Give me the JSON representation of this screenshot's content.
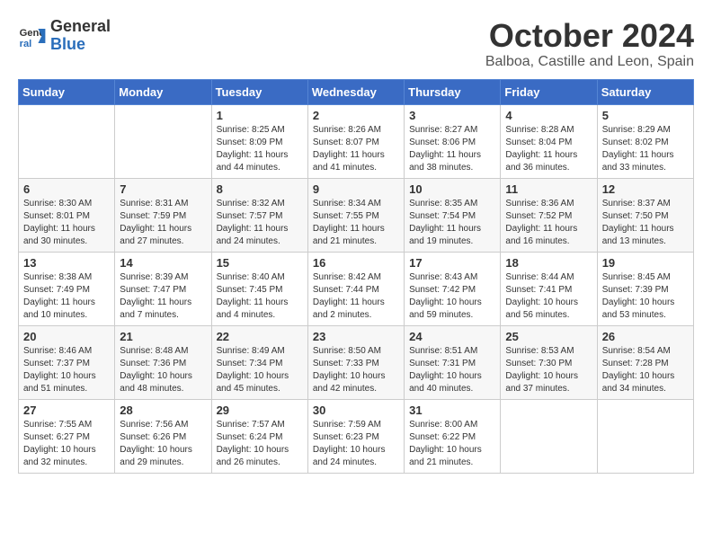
{
  "header": {
    "logo_general": "General",
    "logo_blue": "Blue",
    "month_title": "October 2024",
    "location": "Balboa, Castille and Leon, Spain"
  },
  "days_of_week": [
    "Sunday",
    "Monday",
    "Tuesday",
    "Wednesday",
    "Thursday",
    "Friday",
    "Saturday"
  ],
  "weeks": [
    [
      {
        "day": "",
        "info": ""
      },
      {
        "day": "",
        "info": ""
      },
      {
        "day": "1",
        "info": "Sunrise: 8:25 AM\nSunset: 8:09 PM\nDaylight: 11 hours and 44 minutes."
      },
      {
        "day": "2",
        "info": "Sunrise: 8:26 AM\nSunset: 8:07 PM\nDaylight: 11 hours and 41 minutes."
      },
      {
        "day": "3",
        "info": "Sunrise: 8:27 AM\nSunset: 8:06 PM\nDaylight: 11 hours and 38 minutes."
      },
      {
        "day": "4",
        "info": "Sunrise: 8:28 AM\nSunset: 8:04 PM\nDaylight: 11 hours and 36 minutes."
      },
      {
        "day": "5",
        "info": "Sunrise: 8:29 AM\nSunset: 8:02 PM\nDaylight: 11 hours and 33 minutes."
      }
    ],
    [
      {
        "day": "6",
        "info": "Sunrise: 8:30 AM\nSunset: 8:01 PM\nDaylight: 11 hours and 30 minutes."
      },
      {
        "day": "7",
        "info": "Sunrise: 8:31 AM\nSunset: 7:59 PM\nDaylight: 11 hours and 27 minutes."
      },
      {
        "day": "8",
        "info": "Sunrise: 8:32 AM\nSunset: 7:57 PM\nDaylight: 11 hours and 24 minutes."
      },
      {
        "day": "9",
        "info": "Sunrise: 8:34 AM\nSunset: 7:55 PM\nDaylight: 11 hours and 21 minutes."
      },
      {
        "day": "10",
        "info": "Sunrise: 8:35 AM\nSunset: 7:54 PM\nDaylight: 11 hours and 19 minutes."
      },
      {
        "day": "11",
        "info": "Sunrise: 8:36 AM\nSunset: 7:52 PM\nDaylight: 11 hours and 16 minutes."
      },
      {
        "day": "12",
        "info": "Sunrise: 8:37 AM\nSunset: 7:50 PM\nDaylight: 11 hours and 13 minutes."
      }
    ],
    [
      {
        "day": "13",
        "info": "Sunrise: 8:38 AM\nSunset: 7:49 PM\nDaylight: 11 hours and 10 minutes."
      },
      {
        "day": "14",
        "info": "Sunrise: 8:39 AM\nSunset: 7:47 PM\nDaylight: 11 hours and 7 minutes."
      },
      {
        "day": "15",
        "info": "Sunrise: 8:40 AM\nSunset: 7:45 PM\nDaylight: 11 hours and 4 minutes."
      },
      {
        "day": "16",
        "info": "Sunrise: 8:42 AM\nSunset: 7:44 PM\nDaylight: 11 hours and 2 minutes."
      },
      {
        "day": "17",
        "info": "Sunrise: 8:43 AM\nSunset: 7:42 PM\nDaylight: 10 hours and 59 minutes."
      },
      {
        "day": "18",
        "info": "Sunrise: 8:44 AM\nSunset: 7:41 PM\nDaylight: 10 hours and 56 minutes."
      },
      {
        "day": "19",
        "info": "Sunrise: 8:45 AM\nSunset: 7:39 PM\nDaylight: 10 hours and 53 minutes."
      }
    ],
    [
      {
        "day": "20",
        "info": "Sunrise: 8:46 AM\nSunset: 7:37 PM\nDaylight: 10 hours and 51 minutes."
      },
      {
        "day": "21",
        "info": "Sunrise: 8:48 AM\nSunset: 7:36 PM\nDaylight: 10 hours and 48 minutes."
      },
      {
        "day": "22",
        "info": "Sunrise: 8:49 AM\nSunset: 7:34 PM\nDaylight: 10 hours and 45 minutes."
      },
      {
        "day": "23",
        "info": "Sunrise: 8:50 AM\nSunset: 7:33 PM\nDaylight: 10 hours and 42 minutes."
      },
      {
        "day": "24",
        "info": "Sunrise: 8:51 AM\nSunset: 7:31 PM\nDaylight: 10 hours and 40 minutes."
      },
      {
        "day": "25",
        "info": "Sunrise: 8:53 AM\nSunset: 7:30 PM\nDaylight: 10 hours and 37 minutes."
      },
      {
        "day": "26",
        "info": "Sunrise: 8:54 AM\nSunset: 7:28 PM\nDaylight: 10 hours and 34 minutes."
      }
    ],
    [
      {
        "day": "27",
        "info": "Sunrise: 7:55 AM\nSunset: 6:27 PM\nDaylight: 10 hours and 32 minutes."
      },
      {
        "day": "28",
        "info": "Sunrise: 7:56 AM\nSunset: 6:26 PM\nDaylight: 10 hours and 29 minutes."
      },
      {
        "day": "29",
        "info": "Sunrise: 7:57 AM\nSunset: 6:24 PM\nDaylight: 10 hours and 26 minutes."
      },
      {
        "day": "30",
        "info": "Sunrise: 7:59 AM\nSunset: 6:23 PM\nDaylight: 10 hours and 24 minutes."
      },
      {
        "day": "31",
        "info": "Sunrise: 8:00 AM\nSunset: 6:22 PM\nDaylight: 10 hours and 21 minutes."
      },
      {
        "day": "",
        "info": ""
      },
      {
        "day": "",
        "info": ""
      }
    ]
  ]
}
